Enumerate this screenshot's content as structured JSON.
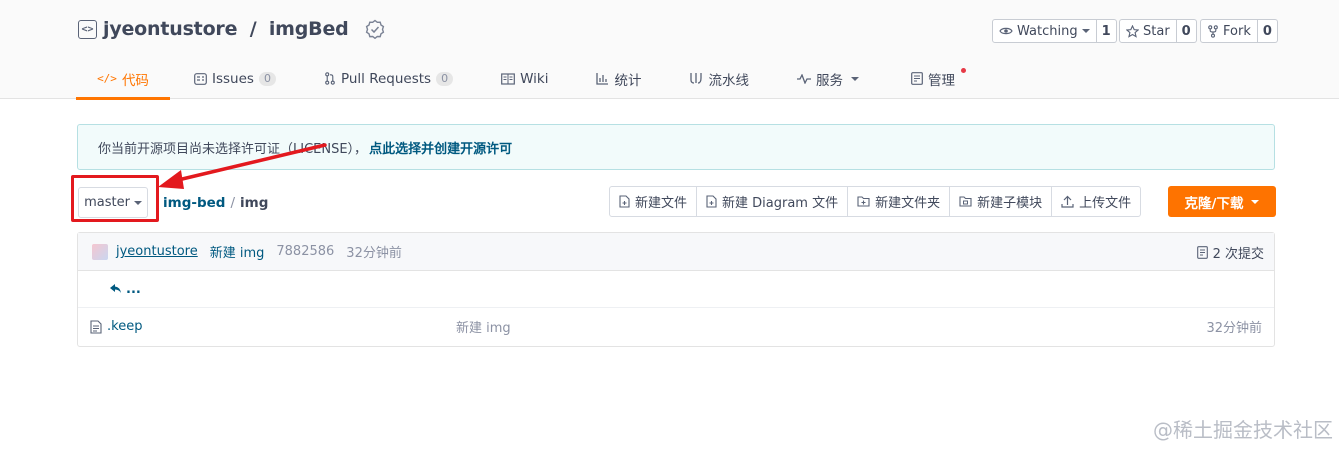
{
  "repo": {
    "owner": "jyeontustore",
    "separator": " / ",
    "name": "imgBed"
  },
  "actions": {
    "watch_label": "Watching",
    "watch_count": "1",
    "star_label": "Star",
    "star_count": "0",
    "fork_label": "Fork",
    "fork_count": "0"
  },
  "nav": {
    "code": "代码",
    "issues": "Issues",
    "issues_count": "0",
    "pulls": "Pull Requests",
    "pulls_count": "0",
    "wiki": "Wiki",
    "stats": "统计",
    "pipeline": "流水线",
    "services": "服务",
    "manage": "管理"
  },
  "notice": {
    "text": "你当前开源项目尚未选择许可证（LICENSE），",
    "link": "点此选择并创建开源许可"
  },
  "branch": {
    "name": "master"
  },
  "breadcrumb": {
    "root": "img-bed",
    "sep": "/",
    "current": "img"
  },
  "file_buttons": {
    "new_file": "新建文件",
    "new_diagram": "新建 Diagram 文件",
    "new_folder": "新建文件夹",
    "new_submodule": "新建子模块",
    "upload": "上传文件"
  },
  "clone": {
    "label": "克隆/下载"
  },
  "commit": {
    "author": "jyeontustore",
    "message": "新建 img",
    "hash": "7882586",
    "time": "32分钟前",
    "count_label": "2 次提交"
  },
  "files": {
    "back": "...",
    "rows": [
      {
        "name": ".keep",
        "commit": "新建 img",
        "time": "32分钟前"
      }
    ]
  },
  "watermark": "@稀土掘金技术社区",
  "colors": {
    "accent": "#fe7300",
    "link": "#005980",
    "highlight": "#e3191e"
  }
}
